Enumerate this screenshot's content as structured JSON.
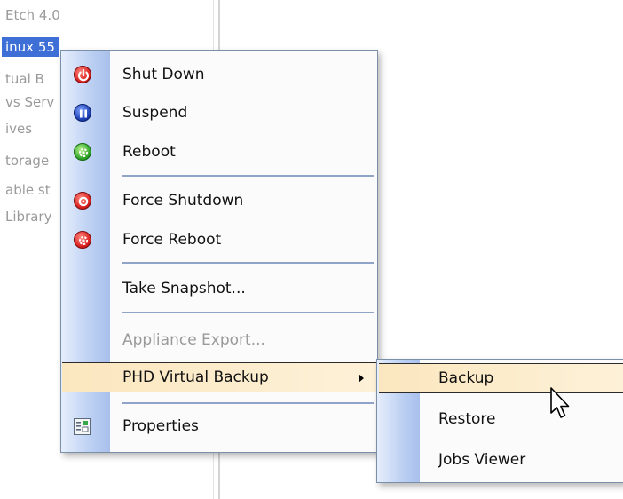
{
  "tree": {
    "items": [
      {
        "label": "Etch 4.0",
        "selected": false
      },
      {
        "label": "inux 55",
        "selected": true
      },
      {
        "label": "tual B",
        "selected": false
      },
      {
        "label": "vs Serv",
        "selected": false
      },
      {
        "label": "ives",
        "selected": false
      },
      {
        "label": "torage",
        "selected": false
      },
      {
        "label": "able st",
        "selected": false
      },
      {
        "label": "Library",
        "selected": false
      }
    ]
  },
  "context_menu": {
    "items": [
      {
        "label": "Shut Down",
        "icon": "power-icon",
        "enabled": true
      },
      {
        "label": "Suspend",
        "icon": "pause-icon",
        "enabled": true
      },
      {
        "label": "Reboot",
        "icon": "reboot-icon",
        "enabled": true
      },
      {
        "label": "Force Shutdown",
        "icon": "force-shutdown-icon",
        "enabled": true
      },
      {
        "label": "Force Reboot",
        "icon": "force-reboot-icon",
        "enabled": true
      },
      {
        "label": "Take Snapshot...",
        "enabled": true
      },
      {
        "label": "Appliance Export...",
        "enabled": false
      },
      {
        "label": "PHD Virtual Backup",
        "has_submenu": true,
        "highlighted": true
      },
      {
        "label": "Properties",
        "icon": "properties-icon",
        "enabled": true
      }
    ]
  },
  "submenu": {
    "items": [
      {
        "label": "Backup",
        "highlighted": true
      },
      {
        "label": "Restore"
      },
      {
        "label": "Jobs Viewer"
      }
    ]
  },
  "colors": {
    "selection": "#3d6fd6",
    "highlight": "#fbe7bf",
    "gutter": "#bcd0f3",
    "separator": "#8fa4c8",
    "disabled_text": "#9a9a9a"
  }
}
